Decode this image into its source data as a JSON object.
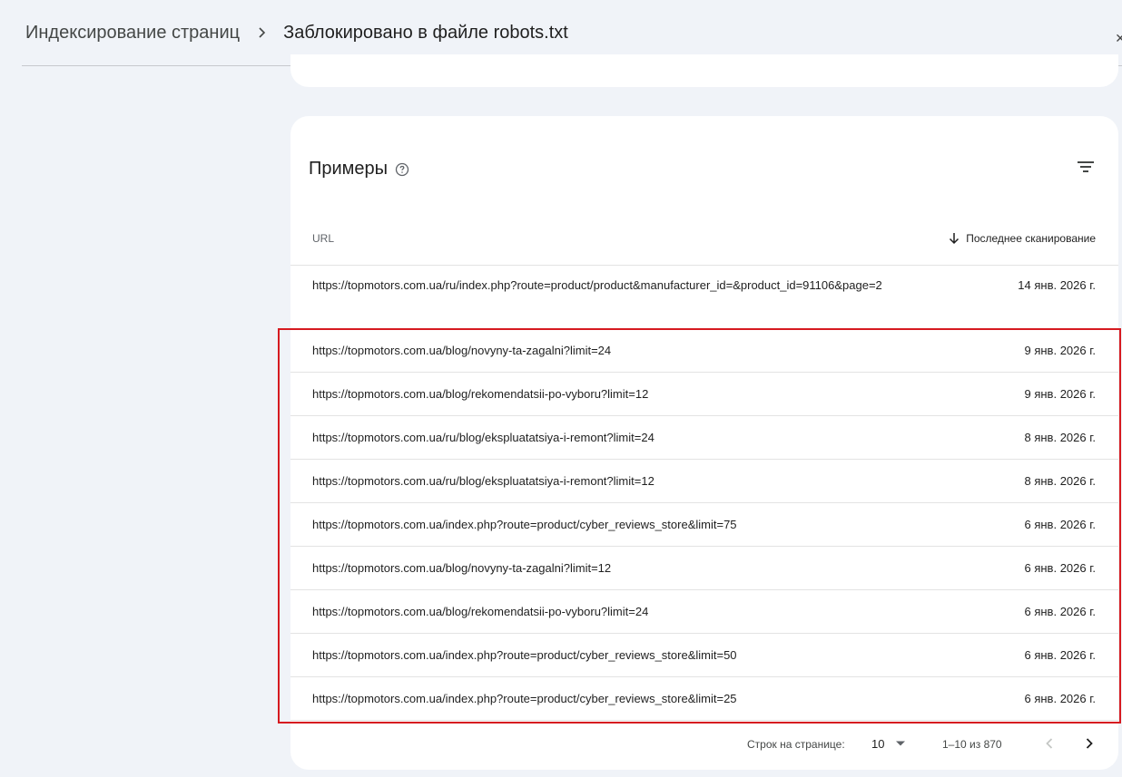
{
  "breadcrumb": {
    "parent": "Индексирование страниц",
    "current": "Заблокировано в файле robots.txt"
  },
  "examples": {
    "title": "Примеры",
    "columns": {
      "url": "URL",
      "last_crawl": "Последнее сканирование"
    },
    "rows": [
      {
        "url": "https://topmotors.com.ua/ru/index.php?route=product/product&manufacturer_id=&product_id=91106&page=2",
        "date": "14 янв. 2026 г."
      },
      {
        "url": "https://topmotors.com.ua/blog/novyny-ta-zagalni?limit=24",
        "date": "9 янв. 2026 г."
      },
      {
        "url": "https://topmotors.com.ua/blog/rekomendatsii-po-vyboru?limit=12",
        "date": "9 янв. 2026 г."
      },
      {
        "url": "https://topmotors.com.ua/ru/blog/ekspluatatsiya-i-remont?limit=24",
        "date": "8 янв. 2026 г."
      },
      {
        "url": "https://topmotors.com.ua/ru/blog/ekspluatatsiya-i-remont?limit=12",
        "date": "8 янв. 2026 г."
      },
      {
        "url": "https://topmotors.com.ua/index.php?route=product/cyber_reviews_store&limit=75",
        "date": "6 янв. 2026 г."
      },
      {
        "url": "https://topmotors.com.ua/blog/novyny-ta-zagalni?limit=12",
        "date": "6 янв. 2026 г."
      },
      {
        "url": "https://topmotors.com.ua/blog/rekomendatsii-po-vyboru?limit=24",
        "date": "6 янв. 2026 г."
      },
      {
        "url": "https://topmotors.com.ua/index.php?route=product/cyber_reviews_store&limit=50",
        "date": "6 янв. 2026 г."
      },
      {
        "url": "https://topmotors.com.ua/index.php?route=product/cyber_reviews_store&limit=25",
        "date": "6 янв. 2026 г."
      }
    ]
  },
  "pagination": {
    "rows_per_page_label": "Строк на странице:",
    "rows_per_page": "10",
    "range": "1–10 из 870"
  },
  "icons": {
    "breadcrumb_separator": "chevron-right-icon",
    "help": "help-circle-icon",
    "filter": "filter-list-icon",
    "sort": "arrow-down-icon",
    "dropdown": "caret-down-icon",
    "prev": "chevron-left-icon",
    "next": "chevron-right-icon"
  },
  "colors": {
    "highlight_border": "#d61a20",
    "page_background": "#f0f3f8",
    "card_background": "#ffffff"
  }
}
